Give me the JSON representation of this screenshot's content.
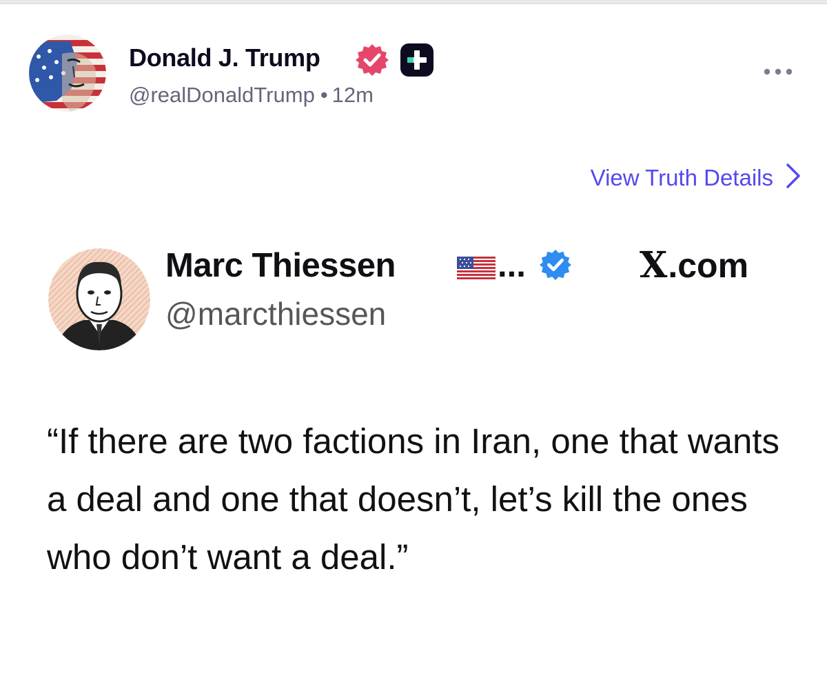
{
  "post": {
    "author_name": "Donald J. Trump",
    "author_handle": "@realDonaldTrump",
    "separator": "•",
    "time_ago": "12m",
    "view_details_label": "View Truth Details",
    "icons": {
      "verified": "verified-badge-icon",
      "plus": "truth-plus-icon",
      "more": "more-options-icon",
      "chevron": "chevron-right-icon"
    },
    "colors": {
      "verified_badge": "#e5476b",
      "link": "#5448ee"
    }
  },
  "embedded_tweet": {
    "name": "Marc Thiessen",
    "ellipsis": "...",
    "handle": "@marcthiessen",
    "source_logo": "X",
    "source_suffix": ".com",
    "text": "“If there are two factions in Iran, one that wants a deal and one that doesn’t, let’s kill the ones who don’t want a deal.”",
    "icons": {
      "flag": "us-flag-icon",
      "verified": "verified-badge-icon"
    },
    "colors": {
      "verified_badge": "#2f8cf0"
    }
  }
}
